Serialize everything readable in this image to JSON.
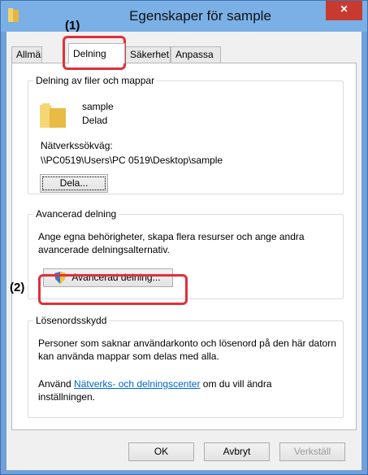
{
  "window": {
    "title": "Egenskaper för sample",
    "close_glyph": "×"
  },
  "tabs": [
    {
      "label": "Allmänt"
    },
    {
      "label": "Delning"
    },
    {
      "label": "Säkerhet"
    },
    {
      "label": "Anpassa"
    }
  ],
  "sharing": {
    "group_title": "Delning av filer och mappar",
    "folder_name": "sample",
    "folder_status": "Delad",
    "path_label": "Nätverkssökväg:",
    "path_value": "\\\\PC0519\\Users\\PC 0519\\Desktop\\sample",
    "share_button": "Dela..."
  },
  "advanced": {
    "group_title": "Avancerad delning",
    "description": "Ange egna behörigheter, skapa flera resurser och ange andra avancerade delningsalternativ.",
    "button": "Avancerad delning..."
  },
  "password": {
    "group_title": "Lösenordsskydd",
    "description": "Personer som saknar användarkonto och lösenord på den här datorn kan använda mappar som delas med alla.",
    "use_prefix": "Använd ",
    "link_text": "Nätverks- och delningscenter",
    "use_suffix": " om du vill ändra inställningen."
  },
  "footer": {
    "ok": "OK",
    "cancel": "Avbryt",
    "apply": "Verkställ"
  },
  "annotations": {
    "step1": "(1)",
    "step2": "(2)"
  },
  "colors": {
    "accent": "#7bb0e6",
    "close": "#c83a2f",
    "annotation": "#e0303b",
    "link": "#0066cc"
  }
}
